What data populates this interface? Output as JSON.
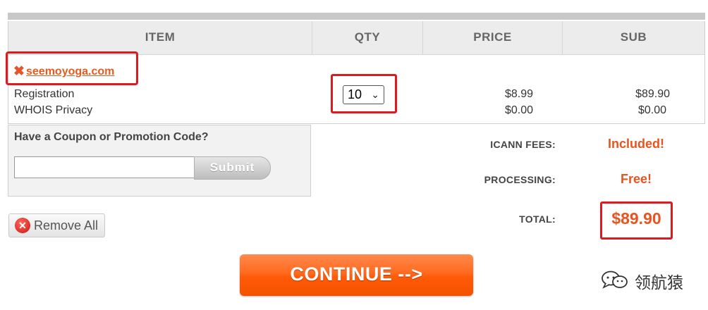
{
  "table": {
    "headers": {
      "item": "ITEM",
      "qty": "QTY",
      "price": "PRICE",
      "sub": "SUB"
    }
  },
  "cart_item": {
    "domain": "seemoyoga.com",
    "remove_icon": "x-icon",
    "qty": "10",
    "lines": [
      {
        "label": "Registration",
        "price": "$8.99",
        "sub": "$89.90"
      },
      {
        "label": "WHOIS Privacy",
        "price": "$0.00",
        "sub": "$0.00"
      }
    ]
  },
  "coupon": {
    "title": "Have a Coupon or Promotion Code?",
    "input_value": "",
    "submit_label": "Submit"
  },
  "fees": {
    "icann_label": "ICANN FEES:",
    "icann_value": "Included!",
    "processing_label": "PROCESSING:",
    "processing_value": "Free!",
    "total_label": "TOTAL:",
    "total_value": "$89.90"
  },
  "remove_all_label": "Remove All",
  "continue_label": "CONTINUE -->",
  "watermark_text": "领航猿",
  "colors": {
    "accent_orange": "#e8541f",
    "highlight_red": "#e0191f",
    "header_bg": "#ececec"
  }
}
